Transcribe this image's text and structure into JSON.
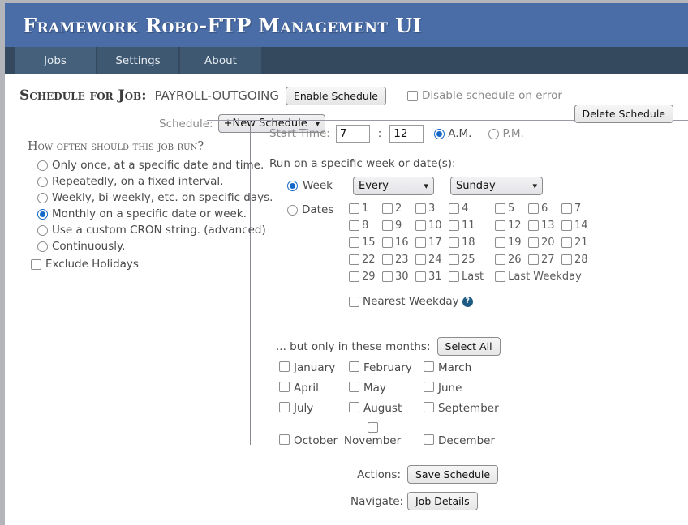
{
  "app": {
    "banner_title": "Framework Robo-FTP Management UI",
    "accent_color": "#4a6da7",
    "tabbar_color": "#34495e"
  },
  "tabs": [
    {
      "label": "Jobs",
      "active": true
    },
    {
      "label": "Settings",
      "active": false
    },
    {
      "label": "About",
      "active": false
    }
  ],
  "schedule_header": {
    "title": "Schedule for Job:",
    "job_name": "PAYROLL-OUTGOING",
    "enable_button": "Enable Schedule",
    "disable_on_error_label": "Disable schedule on error",
    "disable_on_error_checked": false,
    "schedule_label": "Schedule:",
    "schedule_value": "+New Schedule",
    "delete_button": "Delete Schedule"
  },
  "frequency": {
    "title": "How often should this job run?",
    "options": [
      {
        "label": "Only once, at a specific date and time.",
        "selected": false
      },
      {
        "label": "Repeatedly, on a fixed interval.",
        "selected": false
      },
      {
        "label": "Weekly, bi-weekly, etc. on specific days.",
        "selected": false
      },
      {
        "label": "Monthly on a specific date or week.",
        "selected": true
      },
      {
        "label": "Use a custom CRON string. (advanced)",
        "selected": false
      },
      {
        "label": "Continuously.",
        "selected": false
      }
    ],
    "exclude_holidays_label": "Exclude Holidays",
    "exclude_holidays_checked": false
  },
  "start_time": {
    "label": "Start Time:",
    "hour": "7",
    "separator": ":",
    "minute": "12",
    "am_label": "A.M.",
    "pm_label": "P.M.",
    "meridiem_selected": "A.M."
  },
  "run_on": {
    "title": "Run on a specific week or date(s):",
    "mode_selected": "Week",
    "week_label": "Week",
    "week_ordinal": "Every",
    "week_day": "Sunday",
    "dates_label": "Dates",
    "date_rows": [
      [
        "1",
        "2",
        "3",
        "4",
        "5",
        "6",
        "7"
      ],
      [
        "8",
        "9",
        "10",
        "11",
        "12",
        "13",
        "14"
      ],
      [
        "15",
        "16",
        "17",
        "18",
        "19",
        "20",
        "21"
      ],
      [
        "22",
        "23",
        "24",
        "25",
        "26",
        "27",
        "28"
      ]
    ],
    "last_row": [
      "29",
      "30",
      "31"
    ],
    "last_label": "Last",
    "last_weekday_label": "Last Weekday",
    "nearest_weekday_label": "Nearest Weekday",
    "help_glyph": "?"
  },
  "months": {
    "title": "... but only in these months:",
    "select_all_button": "Select All",
    "items": [
      {
        "label": "January",
        "checked": false
      },
      {
        "label": "February",
        "checked": false
      },
      {
        "label": "March",
        "checked": false
      },
      {
        "label": "April",
        "checked": false
      },
      {
        "label": "May",
        "checked": false
      },
      {
        "label": "June",
        "checked": false
      },
      {
        "label": "July",
        "checked": false
      },
      {
        "label": "August",
        "checked": false
      },
      {
        "label": "September",
        "checked": false
      },
      {
        "label": "October",
        "checked": false
      },
      {
        "label": "November",
        "checked": false
      },
      {
        "label": "December",
        "checked": false
      }
    ]
  },
  "footer": {
    "actions_label": "Actions:",
    "save_button": "Save Schedule",
    "navigate_label": "Navigate:",
    "job_details_button": "Job Details"
  }
}
